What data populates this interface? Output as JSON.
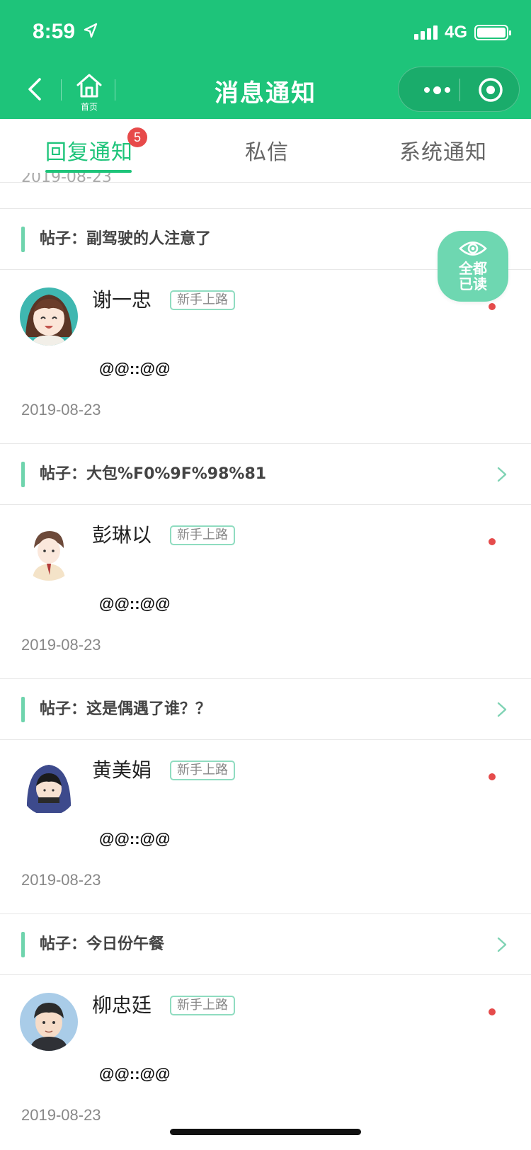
{
  "status_bar": {
    "time": "8:59",
    "network": "4G"
  },
  "nav": {
    "title": "消息通知",
    "home_label": "首页"
  },
  "tabs": [
    {
      "label": "回复通知",
      "badge": "5",
      "active": true
    },
    {
      "label": "私信",
      "active": false
    },
    {
      "label": "系统通知",
      "active": false
    }
  ],
  "partial_date": "2019-08-23",
  "mark_all_read": {
    "line1": "全都",
    "line2": "已读"
  },
  "items": [
    {
      "post_label": "帖子：副驾驶的人注意了",
      "user": "谢一忠",
      "level": "新手上路",
      "content": "@@::@@",
      "date": "2019-08-23"
    },
    {
      "post_label": "帖子：大包%F0%9F%98%81",
      "user": "彭琳以",
      "level": "新手上路",
      "content": "@@::@@",
      "date": "2019-08-23"
    },
    {
      "post_label": "帖子：这是偶遇了谁？？",
      "user": "黄美娟",
      "level": "新手上路",
      "content": "@@::@@",
      "date": "2019-08-23"
    },
    {
      "post_label": "帖子：今日份午餐",
      "user": "柳忠廷",
      "level": "新手上路",
      "content": "@@::@@",
      "date": "2019-08-23"
    }
  ]
}
